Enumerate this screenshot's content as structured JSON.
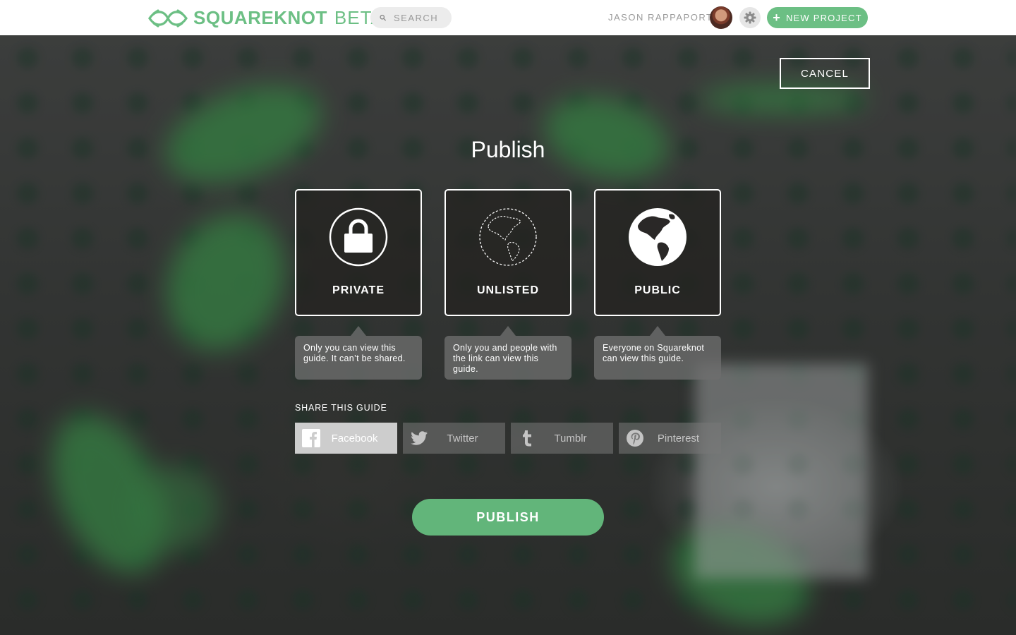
{
  "header": {
    "logo_text": "SQUAREKNOT",
    "logo_suffix": "BETA",
    "search_placeholder": "SEARCH",
    "username": "JASON RAPPAPORT",
    "new_project_label": "NEW PROJECT"
  },
  "dialog": {
    "cancel_label": "CANCEL",
    "title": "Publish",
    "options": [
      {
        "label": "PRIVATE",
        "icon": "lock-icon",
        "description": "Only you can view this guide. It can’t be shared."
      },
      {
        "label": "UNLISTED",
        "icon": "dashed-globe-icon",
        "description": "Only you and people with the link can view this guide."
      },
      {
        "label": "PUBLIC",
        "icon": "globe-icon",
        "description": "Everyone on Squareknot can view this guide."
      }
    ],
    "share_heading": "SHARE THIS GUIDE",
    "share_buttons": [
      {
        "label": "Facebook",
        "icon": "facebook-icon",
        "active": true
      },
      {
        "label": "Twitter",
        "icon": "twitter-icon",
        "active": false
      },
      {
        "label": "Tumblr",
        "icon": "tumblr-icon",
        "active": false
      },
      {
        "label": "Pinterest",
        "icon": "pinterest-icon",
        "active": false
      }
    ],
    "publish_label": "PUBLISH"
  },
  "colors": {
    "brand_green": "#6cbf84",
    "publish_green": "#62b57a",
    "text_white": "#ffffff"
  }
}
